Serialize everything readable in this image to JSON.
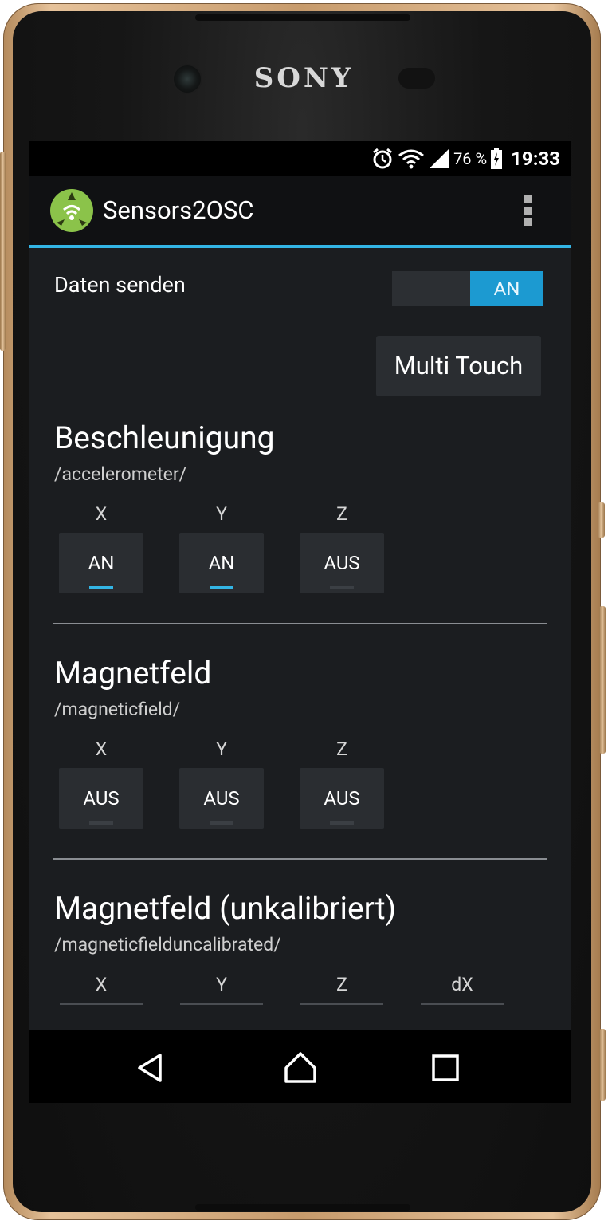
{
  "device": {
    "brand": "SONY"
  },
  "status_bar": {
    "battery_percent": "76 %",
    "time": "19:33"
  },
  "app_bar": {
    "title": "Sensors2OSC"
  },
  "send_row": {
    "label": "Daten senden",
    "toggle_value": "AN"
  },
  "multi_touch_button": "Multi Touch",
  "sections": [
    {
      "title": "Beschleunigung",
      "path": "/accelerometer/",
      "axes": [
        {
          "label": "X",
          "value": "AN"
        },
        {
          "label": "Y",
          "value": "AN"
        },
        {
          "label": "Z",
          "value": "AUS"
        }
      ]
    },
    {
      "title": "Magnetfeld",
      "path": "/magneticfield/",
      "axes": [
        {
          "label": "X",
          "value": "AUS"
        },
        {
          "label": "Y",
          "value": "AUS"
        },
        {
          "label": "Z",
          "value": "AUS"
        }
      ]
    },
    {
      "title": "Magnetfeld (unkalibriert)",
      "path": "/magneticfielduncalibrated/",
      "axes": [
        {
          "label": "X"
        },
        {
          "label": "Y"
        },
        {
          "label": "Z"
        },
        {
          "label": "dX"
        }
      ]
    }
  ],
  "colors": {
    "accent": "#33b5e5",
    "toggle_on": "#1c9ad1",
    "app_icon": "#8bc34a"
  },
  "icons": {
    "status": [
      "alarm-icon",
      "wifi-icon",
      "signal-icon",
      "battery-icon"
    ],
    "nav": [
      "back-icon",
      "home-icon",
      "recents-icon"
    ]
  }
}
